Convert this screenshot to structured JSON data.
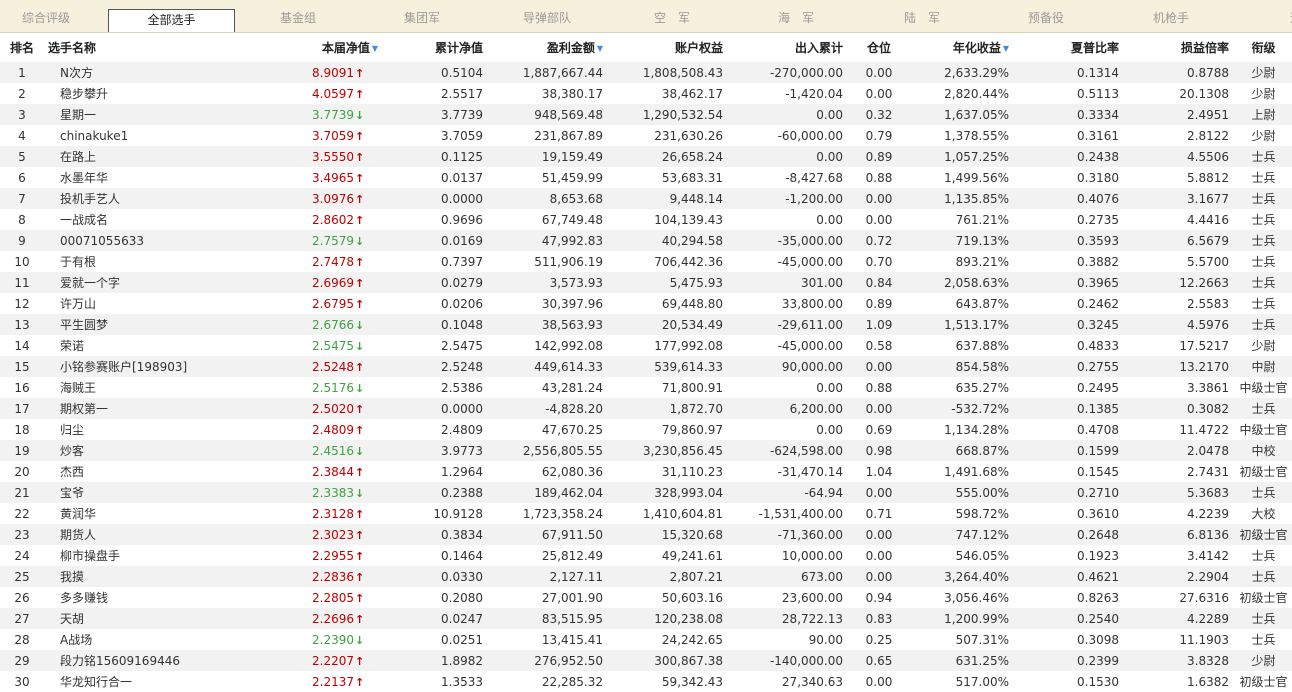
{
  "tabs": [
    {
      "label": "综合评级",
      "active": false
    },
    {
      "label": "全部选手",
      "active": true
    },
    {
      "label": "基金组",
      "active": false
    },
    {
      "label": "集团军",
      "active": false
    },
    {
      "label": "导弹部队",
      "active": false
    },
    {
      "label": "空　军",
      "active": false
    },
    {
      "label": "海　军",
      "active": false
    },
    {
      "label": "陆　军",
      "active": false
    },
    {
      "label": "预备役",
      "active": false
    },
    {
      "label": "机枪手",
      "active": false
    },
    {
      "label": "远",
      "active": false
    }
  ],
  "headers": {
    "rank": "排名",
    "name": "选手名称",
    "nav": "本届净值",
    "cum_nav": "累计净值",
    "profit": "盈利金额",
    "equity": "账户权益",
    "inout": "出入累计",
    "position": "仓位",
    "annual": "年化收益",
    "sharpe": "夏普比率",
    "pl_ratio": "损益倍率",
    "title": "衔级"
  },
  "rows": [
    {
      "rank": "1",
      "name": "N次方",
      "nav": "8.9091",
      "dir": "up",
      "cum_nav": "0.5104",
      "profit": "1,887,667.44",
      "equity": "1,808,508.43",
      "inout": "-270,000.00",
      "position": "0.00",
      "annual": "2,633.29%",
      "sharpe": "0.1314",
      "pl_ratio": "0.8788",
      "title": "少尉"
    },
    {
      "rank": "2",
      "name": "稳步攀升",
      "nav": "4.0597",
      "dir": "up",
      "cum_nav": "2.5517",
      "profit": "38,380.17",
      "equity": "38,462.17",
      "inout": "-1,420.04",
      "position": "0.00",
      "annual": "2,820.44%",
      "sharpe": "0.5113",
      "pl_ratio": "20.1308",
      "title": "少尉"
    },
    {
      "rank": "3",
      "name": "星期一",
      "nav": "3.7739",
      "dir": "down",
      "cum_nav": "3.7739",
      "profit": "948,569.48",
      "equity": "1,290,532.54",
      "inout": "0.00",
      "position": "0.32",
      "annual": "1,637.05%",
      "sharpe": "0.3334",
      "pl_ratio": "2.4951",
      "title": "上尉"
    },
    {
      "rank": "4",
      "name": "chinakuke1",
      "nav": "3.7059",
      "dir": "up",
      "cum_nav": "3.7059",
      "profit": "231,867.89",
      "equity": "231,630.26",
      "inout": "-60,000.00",
      "position": "0.79",
      "annual": "1,378.55%",
      "sharpe": "0.3161",
      "pl_ratio": "2.8122",
      "title": "少尉"
    },
    {
      "rank": "5",
      "name": "在路上",
      "nav": "3.5550",
      "dir": "up",
      "cum_nav": "0.1125",
      "profit": "19,159.49",
      "equity": "26,658.24",
      "inout": "0.00",
      "position": "0.89",
      "annual": "1,057.25%",
      "sharpe": "0.2438",
      "pl_ratio": "4.5506",
      "title": "士兵"
    },
    {
      "rank": "6",
      "name": "水墨年华",
      "nav": "3.4965",
      "dir": "up",
      "cum_nav": "0.0137",
      "profit": "51,459.99",
      "equity": "53,683.31",
      "inout": "-8,427.68",
      "position": "0.88",
      "annual": "1,499.56%",
      "sharpe": "0.3180",
      "pl_ratio": "5.8812",
      "title": "士兵"
    },
    {
      "rank": "7",
      "name": "投机手艺人",
      "nav": "3.0976",
      "dir": "up",
      "cum_nav": "0.0000",
      "profit": "8,653.68",
      "equity": "9,448.14",
      "inout": "-1,200.00",
      "position": "0.00",
      "annual": "1,135.85%",
      "sharpe": "0.4076",
      "pl_ratio": "3.1677",
      "title": "士兵"
    },
    {
      "rank": "8",
      "name": "一战成名",
      "nav": "2.8602",
      "dir": "up",
      "cum_nav": "0.9696",
      "profit": "67,749.48",
      "equity": "104,139.43",
      "inout": "0.00",
      "position": "0.00",
      "annual": "761.21%",
      "sharpe": "0.2735",
      "pl_ratio": "4.4416",
      "title": "士兵"
    },
    {
      "rank": "9",
      "name": "00071055633",
      "nav": "2.7579",
      "dir": "down",
      "cum_nav": "0.0169",
      "profit": "47,992.83",
      "equity": "40,294.58",
      "inout": "-35,000.00",
      "position": "0.72",
      "annual": "719.13%",
      "sharpe": "0.3593",
      "pl_ratio": "6.5679",
      "title": "士兵"
    },
    {
      "rank": "10",
      "name": "于有根",
      "nav": "2.7478",
      "dir": "up",
      "cum_nav": "0.7397",
      "profit": "511,906.19",
      "equity": "706,442.36",
      "inout": "-45,000.00",
      "position": "0.70",
      "annual": "893.21%",
      "sharpe": "0.3882",
      "pl_ratio": "5.5700",
      "title": "士兵"
    },
    {
      "rank": "11",
      "name": "爱就一个字",
      "nav": "2.6969",
      "dir": "up",
      "cum_nav": "0.0279",
      "profit": "3,573.93",
      "equity": "5,475.93",
      "inout": "301.00",
      "position": "0.84",
      "annual": "2,058.63%",
      "sharpe": "0.3965",
      "pl_ratio": "12.2663",
      "title": "士兵"
    },
    {
      "rank": "12",
      "name": "许万山",
      "nav": "2.6795",
      "dir": "up",
      "cum_nav": "0.0206",
      "profit": "30,397.96",
      "equity": "69,448.80",
      "inout": "33,800.00",
      "position": "0.89",
      "annual": "643.87%",
      "sharpe": "0.2462",
      "pl_ratio": "2.5583",
      "title": "士兵"
    },
    {
      "rank": "13",
      "name": "平生圆梦",
      "nav": "2.6766",
      "dir": "down",
      "cum_nav": "0.1048",
      "profit": "38,563.93",
      "equity": "20,534.49",
      "inout": "-29,611.00",
      "position": "1.09",
      "annual": "1,513.17%",
      "sharpe": "0.3245",
      "pl_ratio": "4.5976",
      "title": "士兵"
    },
    {
      "rank": "14",
      "name": "荣诺",
      "nav": "2.5475",
      "dir": "down",
      "cum_nav": "2.5475",
      "profit": "142,992.08",
      "equity": "177,992.08",
      "inout": "-45,000.00",
      "position": "0.58",
      "annual": "637.88%",
      "sharpe": "0.4833",
      "pl_ratio": "17.5217",
      "title": "少尉"
    },
    {
      "rank": "15",
      "name": "小铭参赛账户[198903]",
      "nav": "2.5248",
      "dir": "up",
      "cum_nav": "2.5248",
      "profit": "449,614.33",
      "equity": "539,614.33",
      "inout": "90,000.00",
      "position": "0.00",
      "annual": "854.58%",
      "sharpe": "0.2755",
      "pl_ratio": "13.2170",
      "title": "中尉"
    },
    {
      "rank": "16",
      "name": "海贼王",
      "nav": "2.5176",
      "dir": "down",
      "cum_nav": "2.5386",
      "profit": "43,281.24",
      "equity": "71,800.91",
      "inout": "0.00",
      "position": "0.88",
      "annual": "635.27%",
      "sharpe": "0.2495",
      "pl_ratio": "3.3861",
      "title": "中级士官"
    },
    {
      "rank": "17",
      "name": "期权第一",
      "nav": "2.5020",
      "dir": "up",
      "cum_nav": "0.0000",
      "profit": "-4,828.20",
      "equity": "1,872.70",
      "inout": "6,200.00",
      "position": "0.00",
      "annual": "-532.72%",
      "sharpe": "0.1385",
      "pl_ratio": "0.3082",
      "title": "士兵"
    },
    {
      "rank": "18",
      "name": "归尘",
      "nav": "2.4809",
      "dir": "up",
      "cum_nav": "2.4809",
      "profit": "47,670.25",
      "equity": "79,860.97",
      "inout": "0.00",
      "position": "0.69",
      "annual": "1,134.28%",
      "sharpe": "0.4708",
      "pl_ratio": "11.4722",
      "title": "中级士官"
    },
    {
      "rank": "19",
      "name": "炒客",
      "nav": "2.4516",
      "dir": "down",
      "cum_nav": "3.9773",
      "profit": "2,556,805.55",
      "equity": "3,230,856.45",
      "inout": "-624,598.00",
      "position": "0.98",
      "annual": "668.87%",
      "sharpe": "0.1599",
      "pl_ratio": "2.0478",
      "title": "中校"
    },
    {
      "rank": "20",
      "name": "杰西",
      "nav": "2.3844",
      "dir": "up",
      "cum_nav": "1.2964",
      "profit": "62,080.36",
      "equity": "31,110.23",
      "inout": "-31,470.14",
      "position": "1.04",
      "annual": "1,491.68%",
      "sharpe": "0.1545",
      "pl_ratio": "2.7431",
      "title": "初级士官"
    },
    {
      "rank": "21",
      "name": "宝爷",
      "nav": "2.3383",
      "dir": "down",
      "cum_nav": "0.2388",
      "profit": "189,462.04",
      "equity": "328,993.04",
      "inout": "-64.94",
      "position": "0.00",
      "annual": "555.00%",
      "sharpe": "0.2710",
      "pl_ratio": "5.3683",
      "title": "士兵"
    },
    {
      "rank": "22",
      "name": "黄润华",
      "nav": "2.3128",
      "dir": "up",
      "cum_nav": "10.9128",
      "profit": "1,723,358.24",
      "equity": "1,410,604.81",
      "inout": "-1,531,400.00",
      "position": "0.71",
      "annual": "598.72%",
      "sharpe": "0.3610",
      "pl_ratio": "4.2239",
      "title": "大校"
    },
    {
      "rank": "23",
      "name": "期货人",
      "nav": "2.3023",
      "dir": "up",
      "cum_nav": "0.3834",
      "profit": "67,911.50",
      "equity": "15,320.68",
      "inout": "-71,360.00",
      "position": "0.00",
      "annual": "747.12%",
      "sharpe": "0.2648",
      "pl_ratio": "6.8136",
      "title": "初级士官"
    },
    {
      "rank": "24",
      "name": "柳市操盘手",
      "nav": "2.2955",
      "dir": "up",
      "cum_nav": "0.1464",
      "profit": "25,812.49",
      "equity": "49,241.61",
      "inout": "10,000.00",
      "position": "0.00",
      "annual": "546.05%",
      "sharpe": "0.1923",
      "pl_ratio": "3.4142",
      "title": "士兵"
    },
    {
      "rank": "25",
      "name": "我摸",
      "nav": "2.2836",
      "dir": "up",
      "cum_nav": "0.0330",
      "profit": "2,127.11",
      "equity": "2,807.21",
      "inout": "673.00",
      "position": "0.00",
      "annual": "3,264.40%",
      "sharpe": "0.4621",
      "pl_ratio": "2.2904",
      "title": "士兵"
    },
    {
      "rank": "26",
      "name": "多多赚钱",
      "nav": "2.2805",
      "dir": "up",
      "cum_nav": "0.2080",
      "profit": "27,001.90",
      "equity": "50,603.16",
      "inout": "23,600.00",
      "position": "0.94",
      "annual": "3,056.46%",
      "sharpe": "0.8263",
      "pl_ratio": "27.6316",
      "title": "初级士官"
    },
    {
      "rank": "27",
      "name": "天胡",
      "nav": "2.2696",
      "dir": "up",
      "cum_nav": "0.0247",
      "profit": "83,515.95",
      "equity": "120,238.08",
      "inout": "28,722.13",
      "position": "0.83",
      "annual": "1,200.99%",
      "sharpe": "0.2540",
      "pl_ratio": "4.2289",
      "title": "士兵"
    },
    {
      "rank": "28",
      "name": "A战场",
      "nav": "2.2390",
      "dir": "down",
      "cum_nav": "0.0251",
      "profit": "13,415.41",
      "equity": "24,242.65",
      "inout": "90.00",
      "position": "0.25",
      "annual": "507.31%",
      "sharpe": "0.3098",
      "pl_ratio": "11.1903",
      "title": "士兵"
    },
    {
      "rank": "29",
      "name": "段力铭15609169446",
      "nav": "2.2207",
      "dir": "up",
      "cum_nav": "1.8982",
      "profit": "276,952.50",
      "equity": "300,867.38",
      "inout": "-140,000.00",
      "position": "0.65",
      "annual": "631.25%",
      "sharpe": "0.2399",
      "pl_ratio": "3.8328",
      "title": "少尉"
    },
    {
      "rank": "30",
      "name": "华龙知行合一",
      "nav": "2.2137",
      "dir": "up",
      "cum_nav": "1.3533",
      "profit": "22,285.32",
      "equity": "59,342.43",
      "inout": "27,340.63",
      "position": "0.00",
      "annual": "517.00%",
      "sharpe": "0.1530",
      "pl_ratio": "1.6382",
      "title": "初级士官"
    }
  ],
  "colors": {
    "up": "#c00000",
    "down": "#3ea33e",
    "tab_bg": "#f6f1dc",
    "row_alt": "#f2f2f2",
    "sort_icon": "#3a8ee6"
  }
}
